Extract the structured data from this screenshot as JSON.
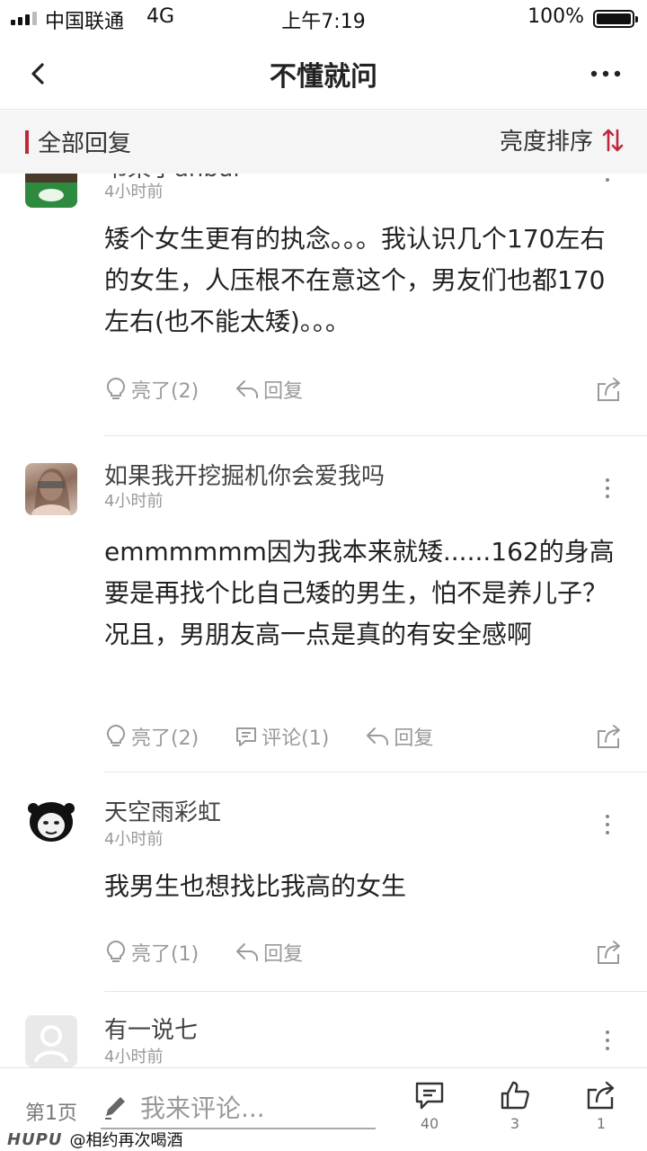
{
  "status_bar": {
    "carrier": "中国联通",
    "network": "4G",
    "time": "上午7:19",
    "battery": "100%"
  },
  "nav": {
    "title": "不懂就问",
    "back_icon": "chevron-left-icon",
    "more_icon": "more-horizontal-icon"
  },
  "section": {
    "title": "全部回复",
    "sort_label": "亮度排序",
    "accent_color": "#c0273a"
  },
  "comments": [
    {
      "username": "书呆子anbui",
      "time": "4小时前",
      "content": "矮个女生更有的执念。。。我认识几个170左右的女生，人压根不在意这个，男友们也都170左右(也不能太矮)。。。",
      "light_label": "亮了(2)",
      "reply_label": "回复"
    },
    {
      "username": "如果我开挖掘机你会爱我吗",
      "time": "4小时前",
      "content": "emmmmmm因为我本来就矮......162的身高要是再找个比自己矮的男生，怕不是养儿子？况且，男朋友高一点是真的有安全感啊",
      "light_label": "亮了(2)",
      "comment_label": "评论(1)",
      "reply_label": "回复"
    },
    {
      "username": "天空雨彩虹",
      "time": "4小时前",
      "content": "我男生也想找比我高的女生",
      "light_label": "亮了(1)",
      "reply_label": "回复"
    },
    {
      "username": "有一说七",
      "time": "4小时前"
    }
  ],
  "bottom_bar": {
    "page_label": "第1页",
    "input_placeholder": "我来评论...",
    "comment_count": "40",
    "like_count": "3",
    "share_count": "1"
  },
  "watermark": {
    "brand": "HUPU",
    "handle": "@相约再次喝酒"
  }
}
